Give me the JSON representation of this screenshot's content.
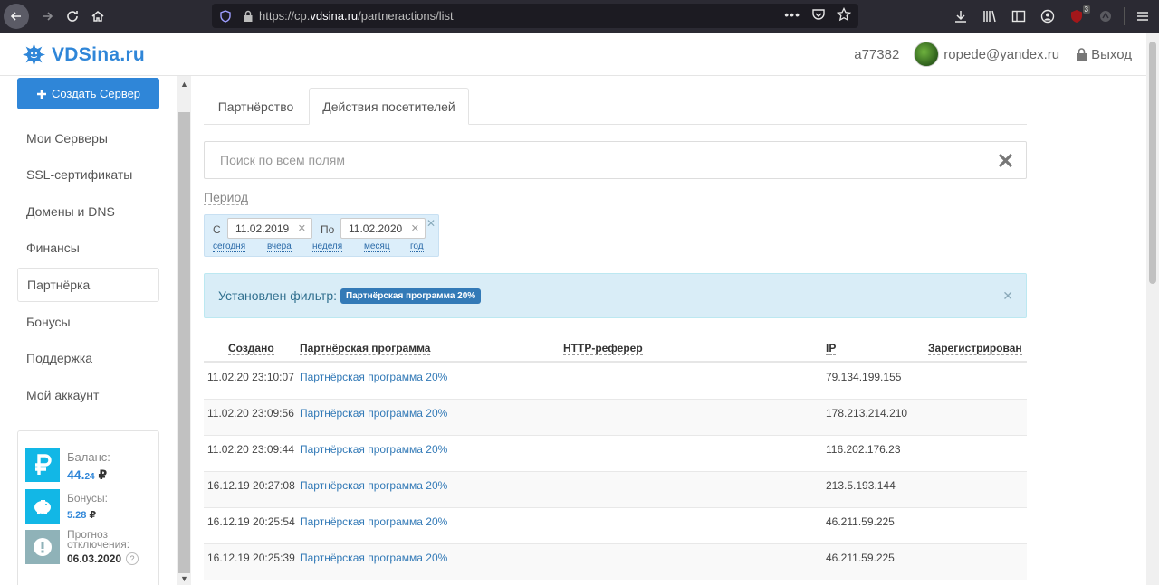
{
  "browser": {
    "url_prefix": "https://cp.",
    "url_domain": "vdsina.ru",
    "url_path": "/partneractions/list",
    "notif_count": "3"
  },
  "header": {
    "logo_text": "VDSina.ru",
    "account_id": "a77382",
    "email": "ropede@yandex.ru",
    "logout_label": "Выход"
  },
  "sidebar": {
    "create_label": "Создать Сервер",
    "items": [
      {
        "label": "Мои Серверы"
      },
      {
        "label": "SSL-сертификаты"
      },
      {
        "label": "Домены и DNS"
      },
      {
        "label": "Финансы"
      },
      {
        "label": "Партнёрка"
      },
      {
        "label": "Бонусы"
      },
      {
        "label": "Поддержка"
      },
      {
        "label": "Мой аккаунт"
      }
    ],
    "balance_label": "Баланс:",
    "balance_int": "44.",
    "balance_dec": "24",
    "balance_currency": "₽",
    "bonus_label": "Бонусы:",
    "bonus_value": "5.28",
    "bonus_currency": "₽",
    "forecast_label": "Прогноз отключения:",
    "forecast_date": "06.03.2020"
  },
  "tabs": [
    {
      "label": "Партнёрство"
    },
    {
      "label": "Действия посетителей"
    }
  ],
  "search": {
    "placeholder": "Поиск по всем полям"
  },
  "period": {
    "label": "Период",
    "from_label": "С",
    "from_date": "11.02.2019",
    "to_label": "По",
    "to_date": "11.02.2020",
    "quick": [
      "сегодня",
      "вчера",
      "неделя",
      "месяц",
      "год"
    ]
  },
  "filter": {
    "text": "Установлен фильтр:",
    "badge": "Партнёрская программа 20%"
  },
  "table": {
    "headers": [
      "Создано",
      "Партнёрская программа",
      "HTTP-реферер",
      "IP",
      "Зарегистрирован"
    ],
    "rows": [
      {
        "created": "11.02.20 23:10:07",
        "program": "Партнёрская программа 20%",
        "referer": "",
        "ip": "79.134.199.155",
        "registered": ""
      },
      {
        "created": "11.02.20 23:09:56",
        "program": "Партнёрская программа 20%",
        "referer": "",
        "ip": "178.213.214.210",
        "registered": ""
      },
      {
        "created": "11.02.20 23:09:44",
        "program": "Партнёрская программа 20%",
        "referer": "",
        "ip": "116.202.176.23",
        "registered": ""
      },
      {
        "created": "16.12.19 20:27:08",
        "program": "Партнёрская программа 20%",
        "referer": "",
        "ip": "213.5.193.144",
        "registered": ""
      },
      {
        "created": "16.12.19 20:25:54",
        "program": "Партнёрская программа 20%",
        "referer": "",
        "ip": "46.211.59.225",
        "registered": ""
      },
      {
        "created": "16.12.19 20:25:39",
        "program": "Партнёрская программа 20%",
        "referer": "",
        "ip": "46.211.59.225",
        "registered": ""
      }
    ]
  },
  "colors": {
    "brand": "#2f86d8",
    "link": "#337ab7",
    "balance_icon_bg": "#12b7e6",
    "forecast_icon_bg": "#8fb2b8"
  }
}
